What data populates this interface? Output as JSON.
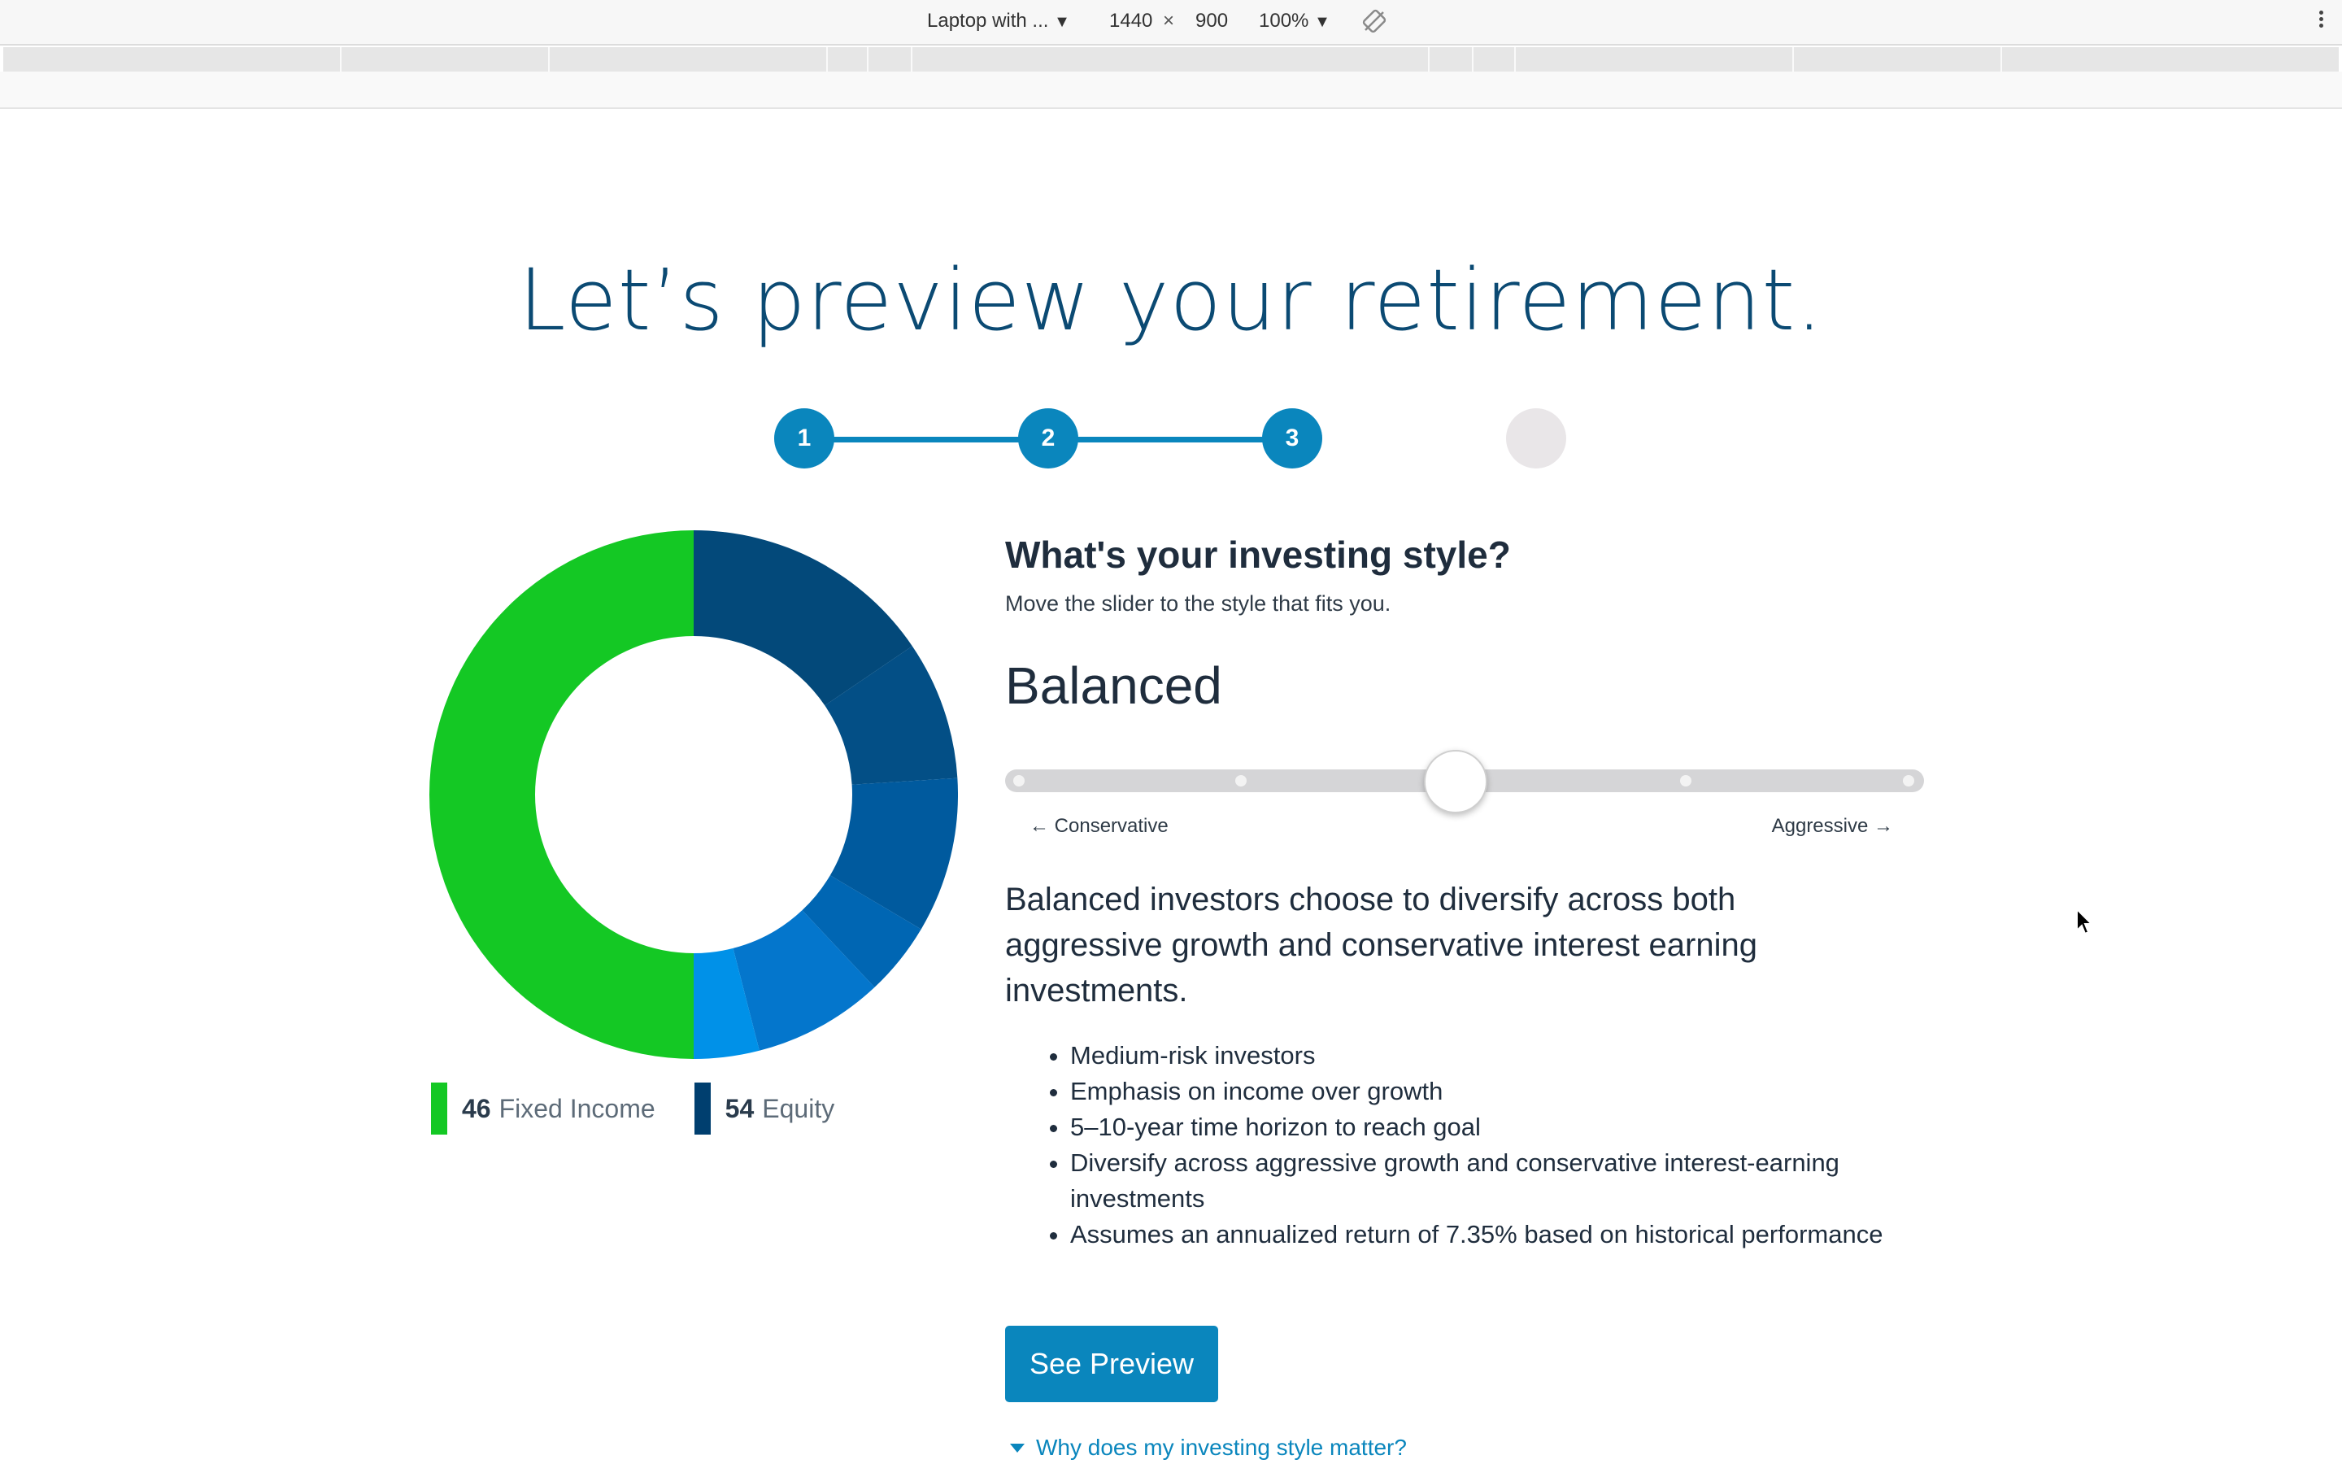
{
  "devtools": {
    "device": "Laptop with ...",
    "width": "1440",
    "times": "×",
    "height": "900",
    "zoom": "100%",
    "dropdown_caret": "▼"
  },
  "page": {
    "title": "Let’s preview your retirement."
  },
  "stepper": {
    "steps": [
      {
        "label": "1",
        "state": "complete"
      },
      {
        "label": "2",
        "state": "complete"
      },
      {
        "label": "3",
        "state": "current"
      },
      {
        "label": "",
        "state": "upcoming"
      }
    ],
    "active_color": "#0a86bd",
    "inactive_color": "#e9e6e8"
  },
  "allocation": {
    "legend": [
      {
        "value": "46",
        "label": "Fixed Income",
        "color": "#14c824"
      },
      {
        "value": "54",
        "label": "Equity",
        "color": "#003f6f"
      }
    ],
    "segments": [
      {
        "percent": 15.5,
        "color": "#03497a"
      },
      {
        "percent": 8.5,
        "color": "#034f86"
      },
      {
        "percent": 9.5,
        "color": "#005a9e"
      },
      {
        "percent": 4.5,
        "color": "#0066b3"
      },
      {
        "percent": 8.0,
        "color": "#0476cc"
      },
      {
        "percent": 4.0,
        "color": "#0091e8"
      },
      {
        "percent": 50.0,
        "color": "#14c824"
      }
    ]
  },
  "question": {
    "title": "What's your investing style?",
    "subtitle": "Move the slider to the style that fits you.",
    "selected_style": "Balanced",
    "slider": {
      "stops": 5,
      "selected_index": 2,
      "left_label": "← Conservative",
      "right_label": "Aggressive →"
    },
    "description": "Balanced investors choose to diversify across both aggressive growth and conservative interest earning investments.",
    "bullets": [
      "Medium-risk investors",
      "Emphasis on income over growth",
      "5–10-year time horizon to reach goal",
      "Diversify across aggressive growth and conservative interest-earning investments",
      "Assumes an annualized return of 7.35% based on historical performance"
    ],
    "cta_label": "See Preview",
    "help_link": "Why does my investing style matter?"
  }
}
